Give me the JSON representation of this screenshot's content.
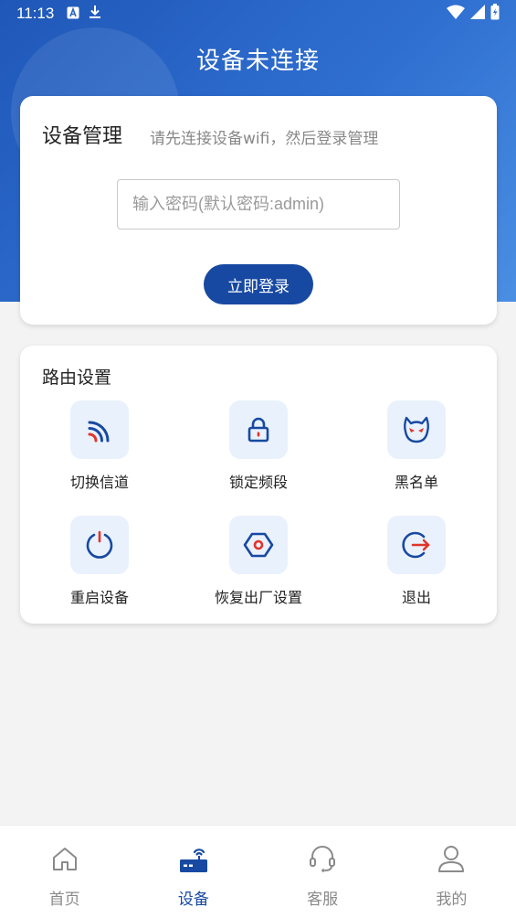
{
  "status": {
    "time": "11:13"
  },
  "header": {
    "title": "设备未连接"
  },
  "manage": {
    "title": "设备管理",
    "hint": "请先连接设备wifi，然后登录管理",
    "password_placeholder": "输入密码(默认密码:admin)",
    "login_label": "立即登录"
  },
  "router": {
    "title": "路由设置",
    "items": [
      {
        "label": "切换信道",
        "icon": "signal-icon"
      },
      {
        "label": "锁定频段",
        "icon": "lock-icon"
      },
      {
        "label": "黑名单",
        "icon": "devil-icon"
      },
      {
        "label": "重启设备",
        "icon": "power-icon"
      },
      {
        "label": "恢复出厂设置",
        "icon": "reset-hexagon-icon"
      },
      {
        "label": "退出",
        "icon": "logout-icon"
      }
    ]
  },
  "tabbar": {
    "items": [
      {
        "label": "首页",
        "icon": "home-icon"
      },
      {
        "label": "设备",
        "icon": "router-icon",
        "active": true
      },
      {
        "label": "客服",
        "icon": "headset-icon"
      },
      {
        "label": "我的",
        "icon": "user-icon"
      }
    ]
  },
  "colors": {
    "primary": "#1749a2",
    "accent_red": "#e0352b",
    "tile_bg": "#e9f1fc"
  }
}
